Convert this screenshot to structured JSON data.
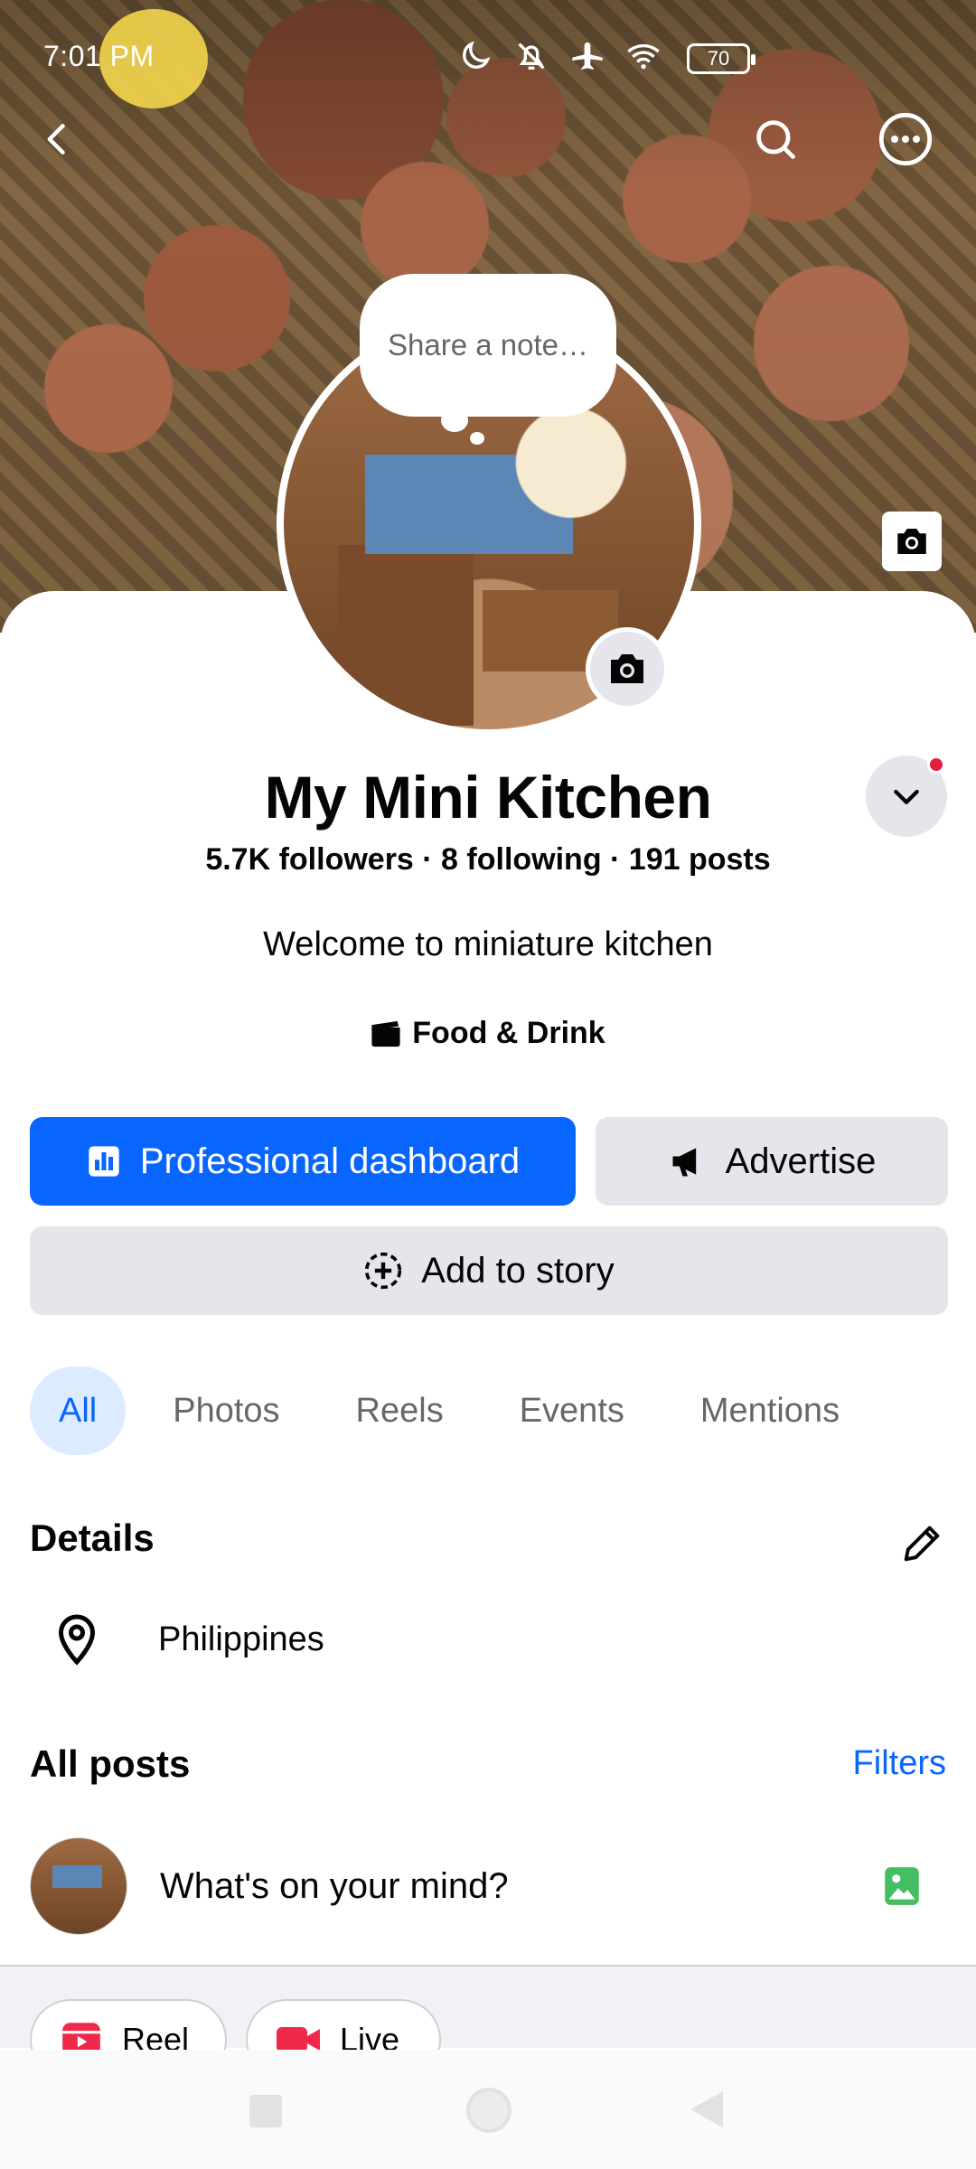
{
  "status_bar": {
    "time": "7:01 PM",
    "battery": "70"
  },
  "profile": {
    "note_placeholder": "Share a note…",
    "name": "My Mini Kitchen",
    "stats": "5.7K followers · 8 following · 191 posts",
    "bio": "Welcome to miniature kitchen",
    "category": "Food & Drink"
  },
  "actions": {
    "professional_dashboard": "Professional dashboard",
    "advertise": "Advertise",
    "add_to_story": "Add to story"
  },
  "tabs": [
    {
      "label": "All",
      "active": true
    },
    {
      "label": "Photos",
      "active": false
    },
    {
      "label": "Reels",
      "active": false
    },
    {
      "label": "Events",
      "active": false
    },
    {
      "label": "Mentions",
      "active": false
    }
  ],
  "details": {
    "title": "Details",
    "location": "Philippines"
  },
  "posts": {
    "title": "All posts",
    "filters": "Filters",
    "composer_placeholder": "What's on your mind?"
  },
  "chips": {
    "reel": "Reel",
    "live": "Live"
  },
  "colors": {
    "accent": "#0866ff",
    "notification": "#e41e3f",
    "photo_icon": "#45bd62",
    "reel_icon": "#f02849"
  },
  "icons": [
    "back-arrow-icon",
    "search-icon",
    "more-icon",
    "camera-icon",
    "chevron-down-icon",
    "clapperboard-icon",
    "bar-chart-icon",
    "megaphone-icon",
    "add-story-icon",
    "pencil-icon",
    "location-pin-icon",
    "photo-icon",
    "reel-icon",
    "live-video-icon"
  ]
}
